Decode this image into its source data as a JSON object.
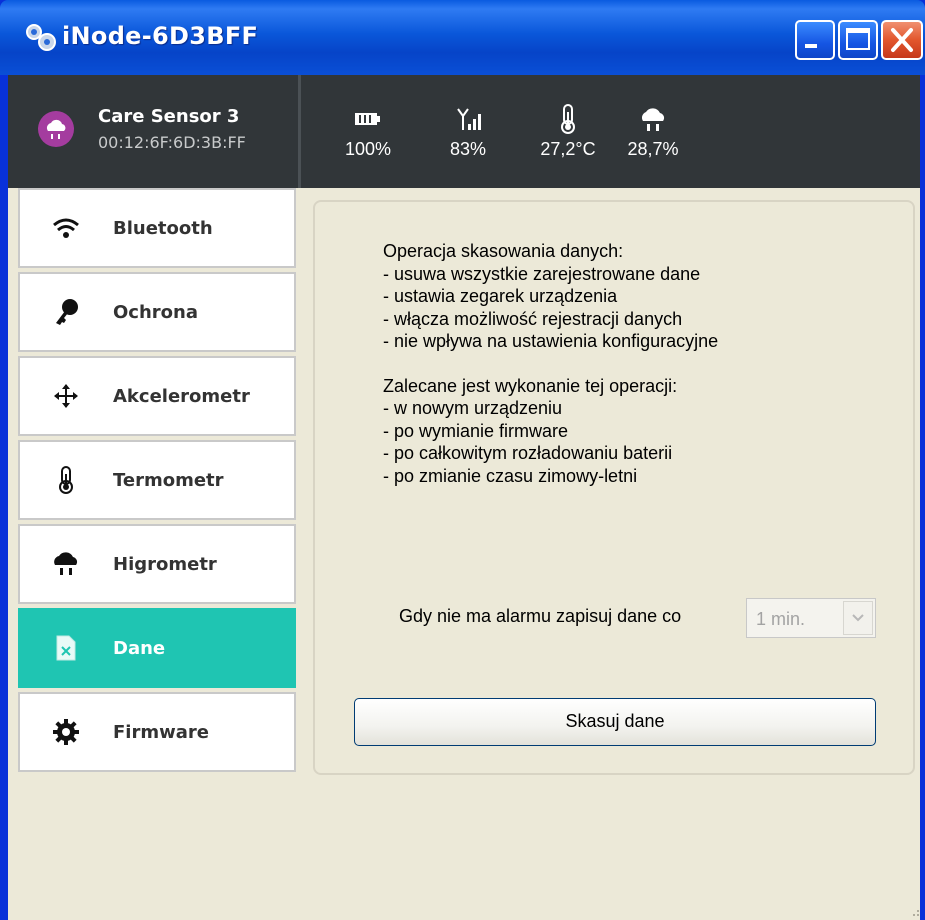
{
  "window": {
    "title": "iNode-6D3BFF"
  },
  "device": {
    "name": "Care Sensor 3",
    "mac": "00:12:6F:6D:3B:FF"
  },
  "stats": [
    {
      "icon": "battery-icon",
      "value": "100%"
    },
    {
      "icon": "signal-icon",
      "value": "83%"
    },
    {
      "icon": "thermometer-icon",
      "value": "27,2°C"
    },
    {
      "icon": "humidity-icon",
      "value": "28,7%"
    }
  ],
  "sidebar": {
    "items": [
      {
        "label": "Bluetooth",
        "icon": "wifi-icon"
      },
      {
        "label": "Ochrona",
        "icon": "key-icon"
      },
      {
        "label": "Akcelerometr",
        "icon": "move-arrows-icon"
      },
      {
        "label": "Termometr",
        "icon": "thermometer-icon"
      },
      {
        "label": "Higrometr",
        "icon": "cloud-rain-icon"
      },
      {
        "label": "Dane",
        "icon": "file-icon"
      },
      {
        "label": "Firmware",
        "icon": "gear-icon"
      }
    ],
    "active": "Dane"
  },
  "panel": {
    "info1_title": "Operacja skasowania danych:",
    "info1_lines": [
      "- usuwa wszystkie zarejestrowane dane",
      "- ustawia zegarek urządzenia",
      "- włącza możliwość rejestracji danych",
      "- nie wpływa na ustawienia konfiguracyjne"
    ],
    "info2_title": "Zalecane jest wykonanie tej operacji:",
    "info2_lines": [
      "- w nowym urządzeniu",
      "- po wymianie firmware",
      "- po całkowitym rozładowaniu baterii",
      "- po zmianie czasu zimowy-letni"
    ],
    "interval_label": "Gdy nie ma alarmu zapisuj dane co",
    "interval_value": "1 min.",
    "clear_button": "Skasuj dane"
  },
  "colors": {
    "accent": "#1fc5b2",
    "header_bg": "#313639",
    "avatar": "#a43c9f"
  }
}
